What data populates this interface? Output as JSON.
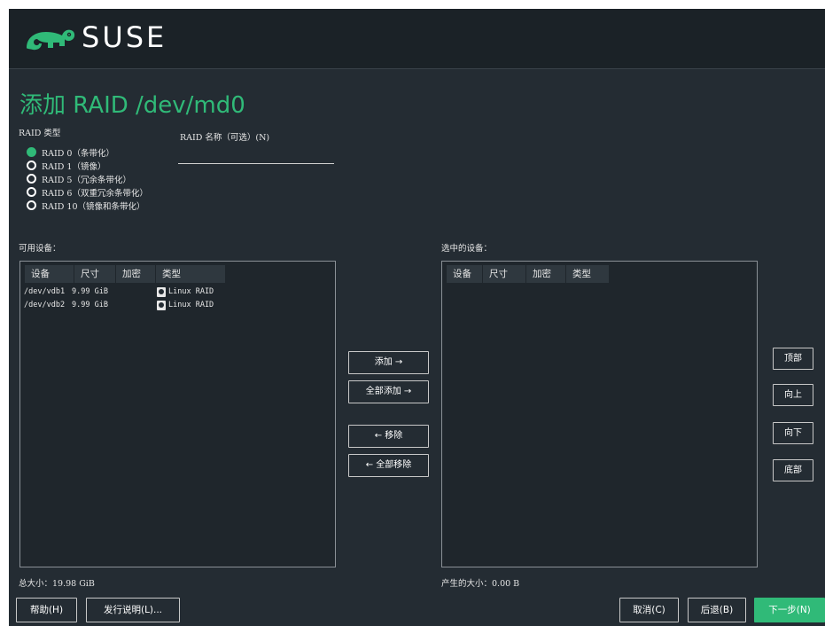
{
  "header": {
    "brand": "SUSE"
  },
  "page_title": "添加 RAID /dev/md0",
  "raid_type": {
    "label": "RAID 类型",
    "options": [
      {
        "label": "RAID 0（条带化）",
        "selected": true
      },
      {
        "label": "RAID 1（镜像）",
        "selected": false
      },
      {
        "label": "RAID 5（冗余条带化）",
        "selected": false
      },
      {
        "label": "RAID 6（双重冗余条带化）",
        "selected": false
      },
      {
        "label": "RAID 10（镜像和条带化）",
        "selected": false
      }
    ]
  },
  "raid_name": {
    "label": "RAID 名称（可选）(N)",
    "value": ""
  },
  "available": {
    "label": "可用设备：",
    "columns": [
      "设备",
      "尺寸",
      "加密",
      "类型"
    ],
    "rows": [
      {
        "device": "/dev/vdb1",
        "size": "9.99 GiB",
        "encrypted": "",
        "type": "Linux RAID"
      },
      {
        "device": "/dev/vdb2",
        "size": "9.99 GiB",
        "encrypted": "",
        "type": "Linux RAID"
      }
    ],
    "total": "总大小：19.98 GiB"
  },
  "selected": {
    "label": "选中的设备：",
    "columns": [
      "设备",
      "尺寸",
      "加密",
      "类型"
    ],
    "rows": [],
    "result": "产生的大小：0.00 B"
  },
  "transfer_buttons": {
    "add": "添加 →",
    "add_all": "全部添加 →",
    "remove": "← 移除",
    "remove_all": "← 全部移除"
  },
  "order_buttons": {
    "top": "顶部",
    "up": "向上",
    "down": "向下",
    "bottom": "底部"
  },
  "footer": {
    "help": "帮助(H)",
    "release_notes": "发行说明(L)...",
    "cancel": "取消(C)",
    "back": "后退(B)",
    "next": "下一步(N)"
  },
  "colors": {
    "accent": "#30ba78",
    "background": "#242c33",
    "header": "#1b2227"
  }
}
